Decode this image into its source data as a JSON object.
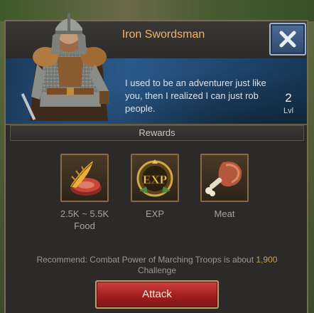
{
  "dialog": {
    "title": "Iron Swordsman",
    "description": "I used to be an adventurer just like you, then I realized I can just rob people.",
    "level_value": "2",
    "level_label": "Lvl",
    "close_icon": "close-x-icon"
  },
  "rewards": {
    "title": "Rewards",
    "items": [
      {
        "name_line1": "2.5K ~ 5.5K",
        "name_line2": "Food",
        "icon": "food-icon"
      },
      {
        "name_line1": "EXP",
        "name_line2": "",
        "icon": "exp-icon"
      },
      {
        "name_line1": "Meat",
        "name_line2": "",
        "icon": "meat-icon"
      }
    ]
  },
  "recommend": {
    "text_before": "Recommend: Combat Power of Marching Troops is about ",
    "power": "1,900",
    "text_after": "Challenge"
  },
  "attack_button": {
    "label": "Attack"
  },
  "colors": {
    "title": "#f0b56a",
    "banner": "#2a5a8a",
    "attack": "#a21f1f",
    "power": "#c4a15a"
  }
}
